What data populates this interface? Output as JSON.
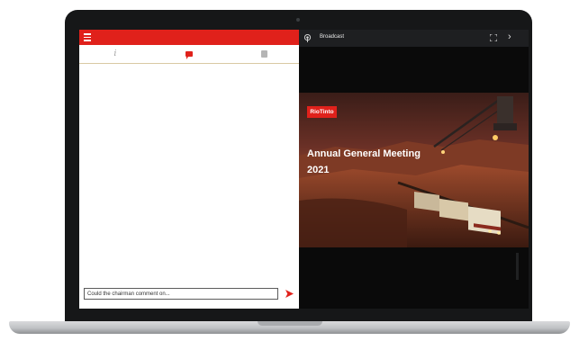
{
  "chat": {
    "tabs": [
      {
        "name": "info",
        "glyph": "i"
      },
      {
        "name": "chat",
        "glyph": "chat-bubble-icon"
      },
      {
        "name": "documents",
        "glyph": "document-icon"
      }
    ],
    "input_value": "Could the chairman comment on..."
  },
  "broadcast": {
    "label": "Broadcast",
    "next_glyph": "›",
    "slide": {
      "logo_text": "RioTinto",
      "title": "Annual General Meeting",
      "year": "2021"
    }
  },
  "colors": {
    "brand_red": "#e0211b",
    "broadcast_bar": "#1e1f21",
    "laptop_bezel": "#161718"
  }
}
